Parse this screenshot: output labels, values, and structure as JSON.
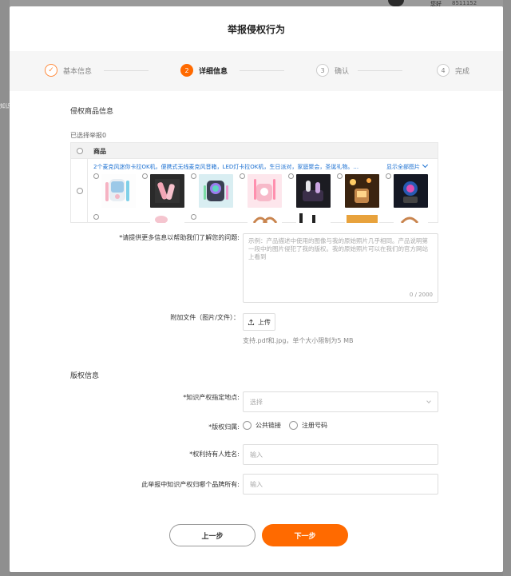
{
  "background": {
    "text1": "您好",
    "text2": "8511152",
    "side_text": "知识"
  },
  "modal": {
    "title": "举报侵权行为"
  },
  "steps": [
    {
      "label": "基本信息",
      "number": "✓",
      "state": "done"
    },
    {
      "label": "详细信息",
      "number": "2",
      "state": "active"
    },
    {
      "label": "确认",
      "number": "3",
      "state": "pending"
    },
    {
      "label": "完成",
      "number": "4",
      "state": "pending"
    }
  ],
  "product_section": {
    "title": "侵权商品信息",
    "selected_count": "已选择举报0",
    "table_header": "商品",
    "description": "2个麦克风迷你卡拉OK机，便携式无线麦克风音箱，LED灯卡拉OK机，生日派对，家庭聚会，圣诞礼物。...",
    "show_all": "显示全部图片"
  },
  "form": {
    "description_label": "*请提供更多信息以帮助我们了解您的问题:",
    "description_placeholder": "示例：产品描述中使用的图像与我的原始照片几乎相同。产品说明第一段中的图片侵犯了我的版权。我的原始照片可以在我们的官方网站上看到",
    "description_counter": "0 / 2000",
    "attachment_label": "附加文件（图片/文件）：",
    "upload_label": "上传",
    "upload_hint": "支持.pdf和.jpg，单个大小限制为5 MB"
  },
  "copyright_section": {
    "title": "版权信息",
    "location_label": "*知识产权指定地点:",
    "location_placeholder": "选择",
    "ownership_label": "*版权归属:",
    "ownership_options": [
      "公共链接",
      "注册号码"
    ],
    "holder_label": "*权利持有人姓名:",
    "holder_placeholder": "输入",
    "brand_label": "此举报中知识产权归哪个品牌所有:",
    "brand_placeholder": "输入"
  },
  "footer": {
    "prev_label": "上一步",
    "next_label": "下一步"
  },
  "colors": {
    "accent": "#ff6a00",
    "link": "#1a6fd1"
  }
}
